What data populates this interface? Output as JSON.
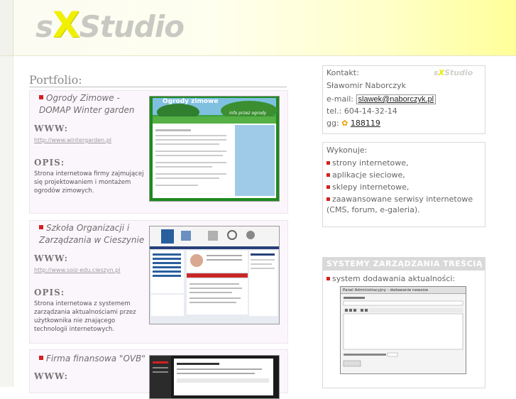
{
  "brand": {
    "logo_left": "s",
    "logo_x": "X",
    "logo_right": "Studio"
  },
  "portfolio": {
    "heading": "Portfolio:",
    "www_label": "WWW:",
    "opis_label": "OPIS:",
    "items": [
      {
        "title": "Ogrody Zimowe - DOMAP Winter garden",
        "url": "http://www.wintergarden.pl",
        "desc": "Strona internetowa firmy zajmującej się projektowaniem i montażem ogrodów zimowych.",
        "shot_title": "Ogrody zimowe",
        "shot_tagline": "info przez ogrody"
      },
      {
        "title": "Szkoła Organizacji i Zarządzania w Cieszynie",
        "url": "http://www.soiz-edu.cieszyn.pl",
        "desc": "Strona internetowa z systemem zarządzania aktualnościami przez użytkownika nie znającego technologii internetowych."
      },
      {
        "title": "Firma finansowa \"OVB\"",
        "url": "",
        "desc": ""
      }
    ]
  },
  "contact": {
    "heading": "Kontakt:",
    "name": "Sławomir Naborczyk",
    "email_label": "e-mail:",
    "email": "slawek@naborczyk.pl",
    "tel_label": "tel.:",
    "tel": "604-14-32-14",
    "gg_label": "gg:",
    "gg": "188119",
    "mini_logo_left": "s",
    "mini_logo_x": "X",
    "mini_logo_right": "Studio"
  },
  "services": {
    "heading": "Wykonuje:",
    "items": [
      "strony internetowe,",
      "aplikacje sieciowe,",
      "sklepy internetowe,",
      "zaawansowane serwisy internetowe"
    ],
    "extra": "(CMS, forum, e-galeria)."
  },
  "cms": {
    "heading": "SYSTEMY ZARZĄDZANIA TREŚCIĄ",
    "item": "system dodawania aktualności:",
    "panel_title": "Panel Administracyjny - dodawanie newsów"
  },
  "colors": {
    "bullet": "#d42020",
    "logo_x": "#f0f000",
    "header_end": "#ffff9a"
  }
}
